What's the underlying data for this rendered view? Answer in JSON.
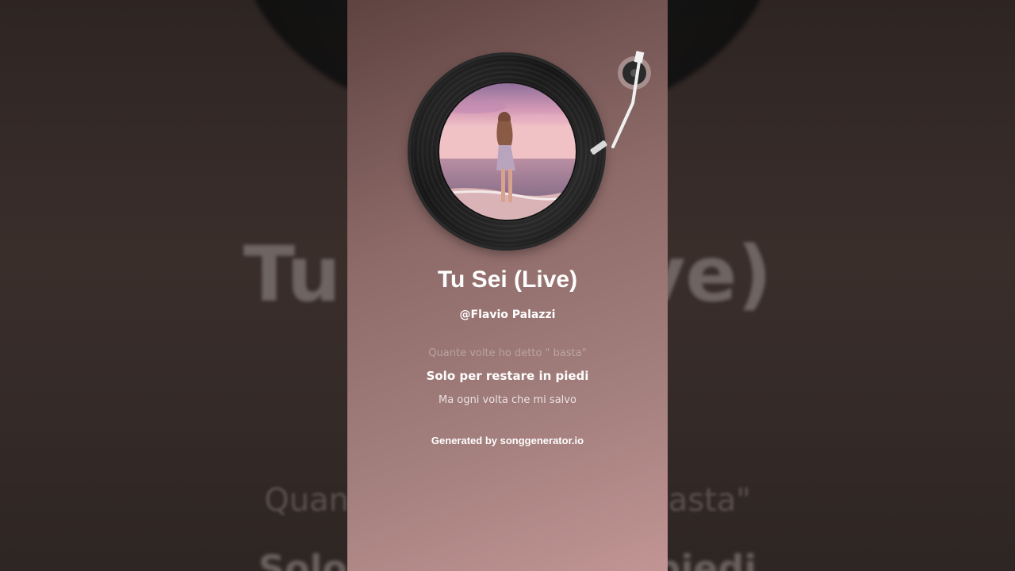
{
  "song": {
    "title": "Tu Sei (Live)",
    "artist": "@Flavio Palazzi"
  },
  "lyrics": {
    "previous": "Quante volte ho detto \" basta\"",
    "current": "Solo per restare in piedi",
    "next": "Ma ogni volta che mi salvo"
  },
  "credit": "Generated by songgenerator.io",
  "background": {
    "title": "Tu Sei (Live)",
    "lyric_previous": "Quante volte ho detto \" basta\"",
    "lyric_current": "Solo per restare in piedi"
  },
  "icons": {
    "record": "vinyl-record-icon",
    "tonearm": "turntable-tonearm-icon"
  },
  "colors": {
    "panel_top": "#5e4341",
    "panel_bottom": "#c19594",
    "text": "#ffffff"
  }
}
